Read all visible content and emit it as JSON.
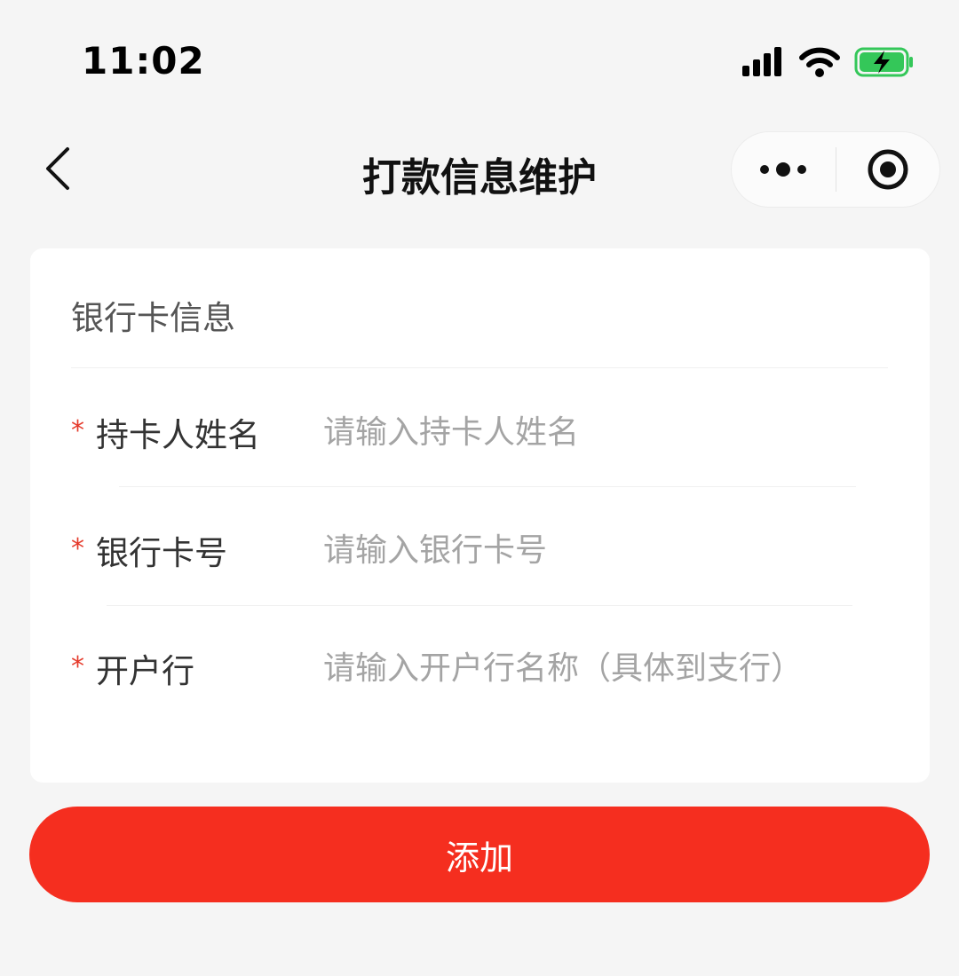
{
  "status_bar": {
    "time": "11:02"
  },
  "nav": {
    "title": "打款信息维护"
  },
  "card": {
    "section_title": "银行卡信息",
    "fields": [
      {
        "required_mark": "*",
        "label": "持卡人姓名",
        "placeholder": "请输入持卡人姓名",
        "value": ""
      },
      {
        "required_mark": "*",
        "label": "银行卡号",
        "placeholder": "请输入银行卡号",
        "value": ""
      },
      {
        "required_mark": "*",
        "label": "开户行",
        "placeholder": "请输入开户行名称（具体到支行）",
        "value": ""
      }
    ]
  },
  "actions": {
    "add_label": "添加"
  },
  "colors": {
    "accent": "#f52e1f",
    "required": "#e53a2b",
    "placeholder": "#a4a4a4",
    "battery": "#34c759"
  },
  "icons": {
    "signal": "signal-icon",
    "wifi": "wifi-icon",
    "battery": "battery-charging-icon",
    "back": "chevron-left-icon",
    "more": "more-dots-icon",
    "close": "target-close-icon"
  }
}
